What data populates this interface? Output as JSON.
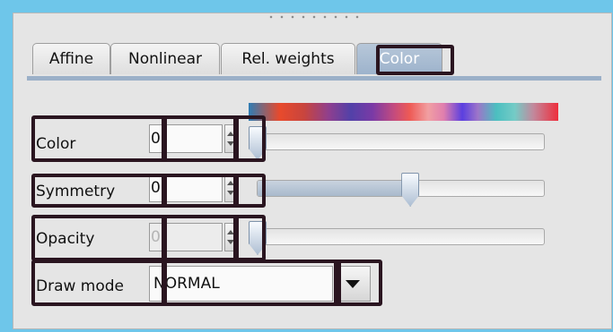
{
  "tabs": [
    {
      "label": "Affine"
    },
    {
      "label": "Nonlinear"
    },
    {
      "label": "Rel. weights"
    },
    {
      "label": "Color",
      "selected": true
    }
  ],
  "spectrum_colors": [
    "#2e7db5",
    "#e84a2c",
    "#8e3f8f",
    "#5241a8",
    "#ee5a55",
    "#f19fa2",
    "#5a3fe0",
    "#4bbfc0",
    "#ee2e3c"
  ],
  "rows": {
    "color": {
      "label": "Color",
      "value": "0",
      "slider_fraction": 0.0
    },
    "symmetry": {
      "label": "Symmetry",
      "value": "0",
      "slider_fraction": 0.53
    },
    "opacity": {
      "label": "Opacity",
      "value": "0",
      "slider_fraction": 0.0
    }
  },
  "draw_mode": {
    "label": "Draw mode",
    "value": "NORMAL"
  },
  "colors": {
    "active_tab": "#9db3cc",
    "marker": "#2a1520",
    "window_border": "#6ec6ea"
  }
}
